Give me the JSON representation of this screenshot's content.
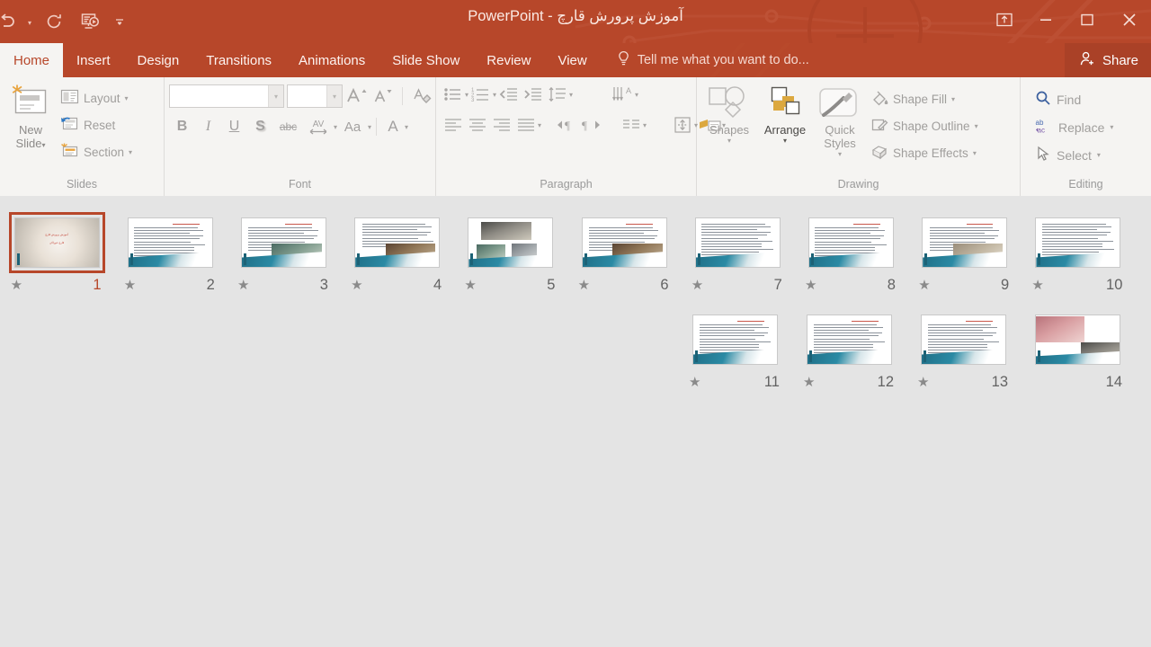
{
  "app": {
    "title": "آموزش پرورش قارچ - PowerPoint",
    "accent_color": "#b7472a",
    "ribbon_bg": "#f5f4f2",
    "panel_bg": "#e4e4e4"
  },
  "quick_access": {
    "undo": "undo-icon",
    "undo_more": "chevron-down-icon",
    "redo": "redo-icon",
    "present": "start-presentation-icon",
    "customize": "customize-quick-access-icon"
  },
  "window_controls": {
    "ribbon_display_options": "ribbon-display-options-icon",
    "minimize": "minimize-icon",
    "restore": "restore-icon",
    "close": "close-icon"
  },
  "tabs": [
    {
      "label": "Home",
      "active": true
    },
    {
      "label": "Insert",
      "active": false
    },
    {
      "label": "Design",
      "active": false
    },
    {
      "label": "Transitions",
      "active": false
    },
    {
      "label": "Animations",
      "active": false
    },
    {
      "label": "Slide Show",
      "active": false
    },
    {
      "label": "Review",
      "active": false
    },
    {
      "label": "View",
      "active": false
    }
  ],
  "tell_me": {
    "icon": "lightbulb-icon",
    "placeholder": "Tell me what you want to do..."
  },
  "share": {
    "icon": "share-person-icon",
    "label": "Share"
  },
  "ribbon": {
    "groups": [
      {
        "name": "slides",
        "label": "Slides",
        "big_button": {
          "line1": "New",
          "line2": "Slide",
          "caret": "▾",
          "icon": "new-slide-icon"
        },
        "items": [
          {
            "label": "Layout",
            "caret": "▾",
            "icon": "layout-icon"
          },
          {
            "label": "Reset",
            "caret": "",
            "icon": "reset-icon"
          },
          {
            "label": "Section",
            "caret": "▾",
            "icon": "section-icon"
          }
        ]
      },
      {
        "name": "font",
        "label": "Font",
        "font_name": {
          "value": "",
          "placeholder": ""
        },
        "font_size": {
          "value": "",
          "placeholder": ""
        },
        "buttons_row1": [
          {
            "icon": "increase-font-size-icon",
            "glyph": "A"
          },
          {
            "icon": "decrease-font-size-icon",
            "glyph": "A"
          },
          {
            "icon": "clear-formatting-icon",
            "glyph": "A"
          }
        ],
        "buttons_row2": [
          {
            "icon": "bold-icon",
            "glyph": "B"
          },
          {
            "icon": "italic-icon",
            "glyph": "I"
          },
          {
            "icon": "underline-icon",
            "glyph": "U"
          },
          {
            "icon": "text-shadow-icon",
            "glyph": "S"
          },
          {
            "icon": "strikethrough-icon",
            "glyph": "abc"
          },
          {
            "icon": "character-spacing-icon",
            "glyph": "AV"
          },
          {
            "icon": "change-case-icon",
            "glyph": "Aa"
          },
          {
            "icon": "font-color-icon",
            "glyph": "A"
          }
        ],
        "dialog_launcher": "font-dialog-launcher"
      },
      {
        "name": "paragraph",
        "label": "Paragraph",
        "buttons_row1": [
          {
            "icon": "bullets-icon"
          },
          {
            "icon": "numbering-icon"
          },
          {
            "icon": "decrease-indent-icon"
          },
          {
            "icon": "increase-indent-icon"
          },
          {
            "icon": "line-spacing-icon"
          },
          {
            "icon": "text-direction-icon"
          }
        ],
        "buttons_row2": [
          {
            "icon": "align-left-icon"
          },
          {
            "icon": "align-center-icon"
          },
          {
            "icon": "align-right-icon"
          },
          {
            "icon": "justify-icon"
          },
          {
            "icon": "ltr-text-direction-icon"
          },
          {
            "icon": "rtl-text-direction-icon"
          },
          {
            "icon": "columns-icon"
          },
          {
            "icon": "align-text-icon"
          },
          {
            "icon": "convert-to-smartart-icon"
          }
        ],
        "dialog_launcher": "paragraph-dialog-launcher"
      },
      {
        "name": "drawing",
        "label": "Drawing",
        "columns": [
          {
            "label": "Shapes",
            "caret": "▾",
            "icon": "shapes-icon",
            "dark": false
          },
          {
            "label": "Arrange",
            "caret": "▾",
            "icon": "arrange-icon",
            "dark": true
          },
          {
            "label": "Quick Styles",
            "caret": "▾",
            "icon": "quick-styles-icon",
            "dark": false
          }
        ],
        "items": [
          {
            "label": "Shape Fill",
            "caret": "▾",
            "icon": "shape-fill-icon"
          },
          {
            "label": "Shape Outline",
            "caret": "▾",
            "icon": "shape-outline-icon"
          },
          {
            "label": "Shape Effects",
            "caret": "▾",
            "icon": "shape-effects-icon"
          }
        ],
        "dialog_launcher": "drawing-dialog-launcher"
      },
      {
        "name": "editing",
        "label": "Editing",
        "items": [
          {
            "label": "Find",
            "caret": "",
            "icon": "find-icon"
          },
          {
            "label": "Replace",
            "caret": "▾",
            "icon": "replace-icon"
          },
          {
            "label": "Select",
            "caret": "▾",
            "icon": "select-icon"
          }
        ]
      }
    ]
  },
  "slide_panel": {
    "direction": "rtl",
    "selected_slide": 1,
    "star_symbol": "★",
    "rows": [
      {
        "slides": [
          {
            "number": "10",
            "has_animation": true,
            "selected": false,
            "kind": "text",
            "title": "",
            "images": []
          },
          {
            "number": "9",
            "has_animation": true,
            "selected": false,
            "kind": "text-image",
            "title": "انواع قارچ",
            "images": [
              "sand"
            ]
          },
          {
            "number": "8",
            "has_animation": true,
            "selected": false,
            "kind": "text",
            "title": "قارچ خوراکی",
            "images": []
          },
          {
            "number": "7",
            "has_animation": true,
            "selected": false,
            "kind": "text",
            "title": "",
            "images": []
          },
          {
            "number": "6",
            "has_animation": true,
            "selected": false,
            "kind": "text-image",
            "title": "کمپوست سازی",
            "images": [
              "brown"
            ]
          },
          {
            "number": "5",
            "has_animation": true,
            "selected": false,
            "kind": "image-grid",
            "title": "",
            "images": [
              "dark",
              "teal",
              "grey"
            ]
          },
          {
            "number": "4",
            "has_animation": true,
            "selected": false,
            "kind": "text-image",
            "title": "",
            "images": [
              "brown"
            ]
          },
          {
            "number": "3",
            "has_animation": true,
            "selected": false,
            "kind": "text-image",
            "title": "پرورش قارچ",
            "images": [
              "teal"
            ]
          },
          {
            "number": "2",
            "has_animation": true,
            "selected": false,
            "kind": "text",
            "title": "مقدمه",
            "images": []
          },
          {
            "number": "1",
            "has_animation": true,
            "selected": true,
            "kind": "title-slide",
            "title": "آموزش پرورش قارچ",
            "subtitle": "قارچ خوراکی",
            "images": [
              "mush"
            ]
          }
        ]
      },
      {
        "slides": [
          {
            "number": "14",
            "has_animation": false,
            "selected": false,
            "kind": "image-grid",
            "title": "",
            "images": [
              "pink",
              "dark"
            ]
          },
          {
            "number": "13",
            "has_animation": true,
            "selected": false,
            "kind": "text",
            "title": "بیماری های قارچ",
            "images": []
          },
          {
            "number": "12",
            "has_animation": true,
            "selected": false,
            "kind": "text",
            "title": "شرایط نگهداری قارچ",
            "images": []
          },
          {
            "number": "11",
            "has_animation": true,
            "selected": false,
            "kind": "text",
            "title": "برداشت قارچ",
            "images": []
          }
        ]
      }
    ]
  }
}
